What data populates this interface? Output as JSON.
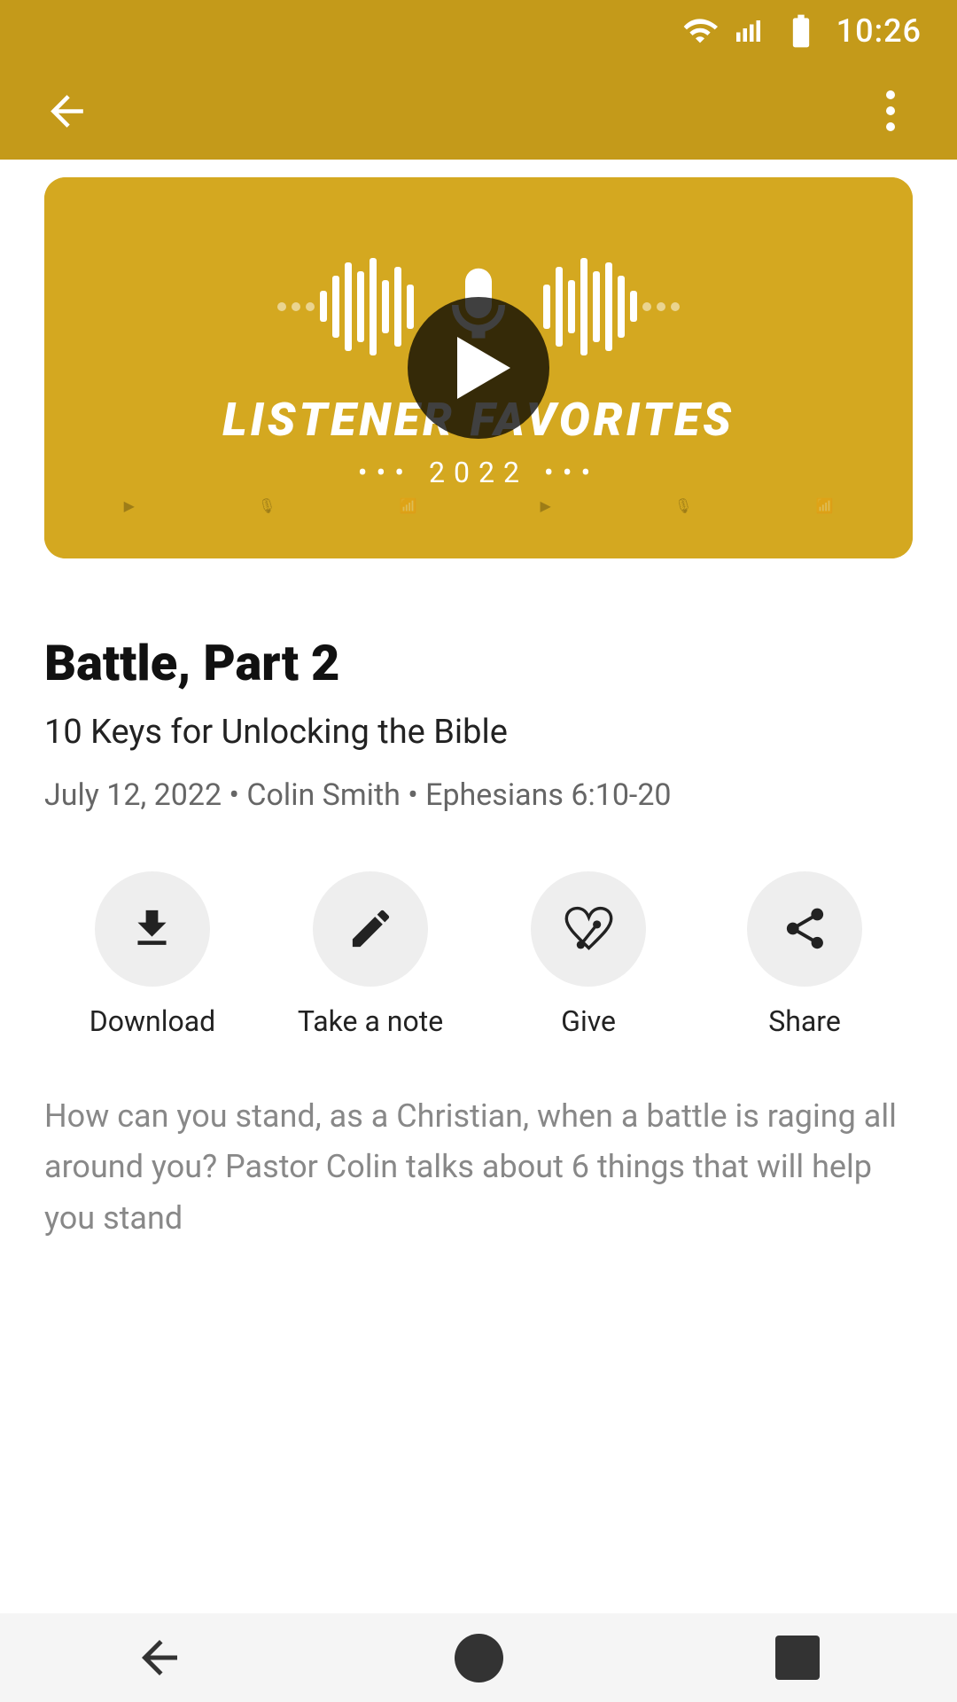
{
  "status": {
    "time": "10:26"
  },
  "header": {
    "back_label": "back",
    "menu_label": "more options"
  },
  "podcast_card": {
    "title": "LISTENER FAVORITES",
    "year": "••• 2022 •••",
    "play_label": "play"
  },
  "episode": {
    "title": "Battle, Part 2",
    "series": "10 Keys for Unlocking the Bible",
    "meta": "July 12, 2022 • Colin Smith • Ephesians 6:10-20",
    "description": "How can you stand, as a Christian, when a battle is raging all around you? Pastor Colin talks about 6 things that will help you stand"
  },
  "actions": [
    {
      "id": "download",
      "label": "Download",
      "icon": "download-icon"
    },
    {
      "id": "take-a-note",
      "label": "Take a note",
      "icon": "note-icon"
    },
    {
      "id": "give",
      "label": "Give",
      "icon": "give-icon"
    },
    {
      "id": "share",
      "label": "Share",
      "icon": "share-icon"
    }
  ],
  "bottom_nav": {
    "back": "back",
    "home": "home",
    "stop": "stop"
  },
  "colors": {
    "accent": "#c49a1a",
    "card_bg": "#d4a820",
    "background": "#ffffff"
  }
}
